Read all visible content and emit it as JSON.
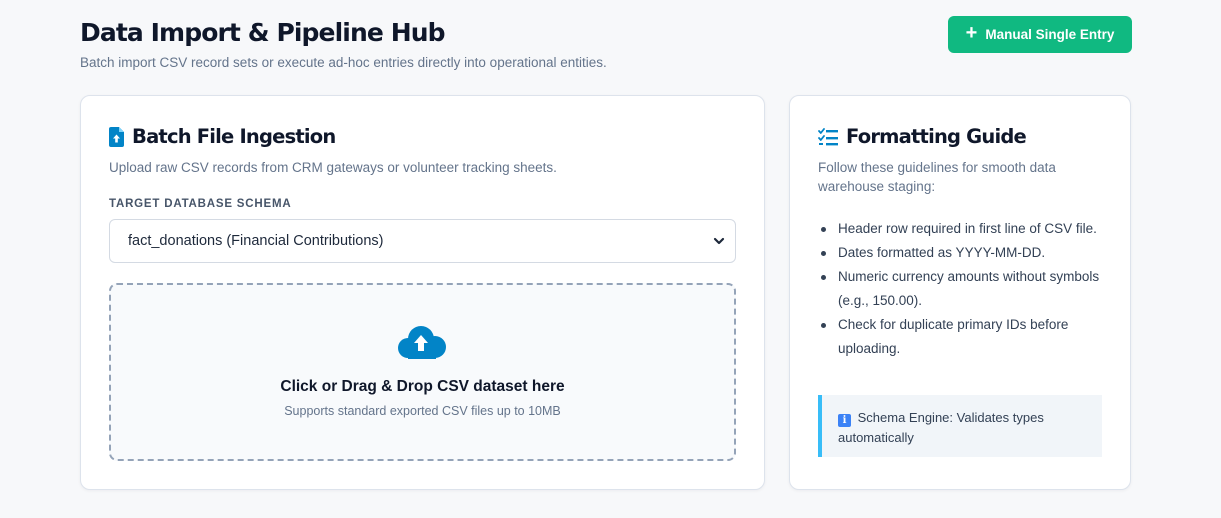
{
  "header": {
    "title": "Data Import & Pipeline Hub",
    "subtitle": "Batch import CSV record sets or execute ad-hoc entries directly into operational entities.",
    "primary_button": {
      "label": "Manual Single Entry",
      "icon": "plus-icon"
    }
  },
  "upload_card": {
    "title": "Batch File Ingestion",
    "icon": "file-upload-icon",
    "description": "Upload raw CSV records from CRM gateways or volunteer tracking sheets.",
    "schema_label": "TARGET DATABASE SCHEMA",
    "schema_select": {
      "selected": "fact_donations (Financial Contributions)"
    },
    "dropzone": {
      "icon": "cloud-upload-icon",
      "title": "Click or Drag & Drop CSV dataset here",
      "subtitle": "Supports standard exported CSV files up to 10MB"
    }
  },
  "guide_card": {
    "title": "Formatting Guide",
    "icon": "checklist-icon",
    "description": "Follow these guidelines for smooth data warehouse staging:",
    "items": [
      "Header row required in first line of CSV file.",
      "Dates formatted as YYYY-MM-DD.",
      "Numeric currency amounts without symbols (e.g., 150.00).",
      "Check for duplicate primary IDs before uploading."
    ],
    "info": {
      "icon": "info-icon",
      "text": "Schema Engine: Validates types automatically"
    }
  },
  "colors": {
    "accent_green": "#10b981",
    "accent_blue": "#0284c7",
    "info_border": "#38bdf8"
  }
}
